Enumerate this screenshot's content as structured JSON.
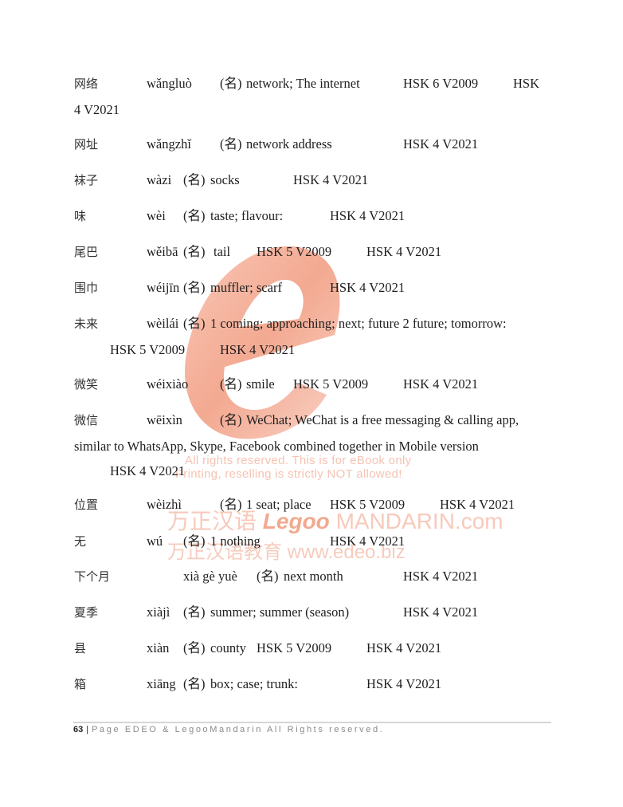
{
  "watermark": {
    "letter": "e",
    "line1": "All rights reserved. This is for eBook only",
    "line2": "Printing, reselling is strictly NOT allowed!",
    "line3_cn": "万正汉语",
    "line3_logo": "Legoo",
    "line3_rest": " MANDARIN.com",
    "line4_cn": "万正汉语教育",
    "line4_url": " www.edeo.biz",
    "color": "#f6c3b3"
  },
  "entries": [
    {
      "hanzi": "网络",
      "pinyin": "wǎngluò",
      "pos": "(名)",
      "def": "network; The internet",
      "hsk_2009": "HSK 6 V2009",
      "hsk_2021": "HSK 4 V2021"
    },
    {
      "hanzi": "网址",
      "pinyin": "wǎngzhǐ",
      "pos": "(名)",
      "def": "network address",
      "hsk_2021": "HSK 4 V2021"
    },
    {
      "hanzi": "袜子",
      "pinyin": "wàzi",
      "pos": "(名)",
      "def": "socks",
      "hsk_2021": "HSK 4 V2021"
    },
    {
      "hanzi": "味",
      "pinyin": "wèi",
      "pos": "(名)",
      "def": "taste; flavour:",
      "hsk_2021": "HSK 4 V2021"
    },
    {
      "hanzi": "尾巴",
      "pinyin": "wěibā",
      "pos": "(名)",
      "def": "tail",
      "hsk_2009": "HSK 5 V2009",
      "hsk_2021": "HSK 4 V2021"
    },
    {
      "hanzi": "围巾",
      "pinyin": "wéijīn",
      "pos": "(名)",
      "def": "muffler; scarf",
      "hsk_2021": "HSK 4 V2021"
    },
    {
      "hanzi": "未来",
      "pinyin": "wèilái",
      "pos": "(名)",
      "def": "1  coming; approaching; next; future  2 future; tomorrow:",
      "hsk_2009": "HSK 5 V2009",
      "hsk_2021": "HSK 4 V2021"
    },
    {
      "hanzi": "微笑",
      "pinyin": "wéixiào",
      "pos": "(名)",
      "def": "smile",
      "hsk_2009": "HSK 5 V2009",
      "hsk_2021": "HSK 4 V2021"
    },
    {
      "hanzi": "微信",
      "pinyin": "wēixìn",
      "pos": "(名)",
      "def": "WeChat; WeChat is a free messaging & calling app,",
      "def_cont": "similar to WhatsApp, Skype, Facebook combined together in Mobile version",
      "hsk_2021": "HSK 4 V2021"
    },
    {
      "hanzi": "位置",
      "pinyin": "wèizhì",
      "pos": "(名)",
      "def": "1 seat; place",
      "hsk_2009": "HSK 5 V2009",
      "hsk_2021": "HSK 4 V2021"
    },
    {
      "hanzi": "无",
      "pinyin": "wú",
      "pos": "(名)",
      "def": "1 nothing",
      "hsk_2021": "HSK 4 V2021"
    },
    {
      "hanzi": "下个月",
      "pinyin": "xià gè yuè",
      "pos": "(名)",
      "def": "next month",
      "hsk_2021": "HSK 4 V2021"
    },
    {
      "hanzi": "夏季",
      "pinyin": "xiàjì",
      "pos": "(名)",
      "def": "summer; summer (season)",
      "hsk_2021": "HSK 4 V2021"
    },
    {
      "hanzi": "县",
      "pinyin": "xiàn",
      "pos": "(名)",
      "def": "county",
      "hsk_2009": "HSK 5 V2009",
      "hsk_2021": "HSK 4 V2021"
    },
    {
      "hanzi": "箱",
      "pinyin": "xiāng",
      "pos": "(名)",
      "def": "box; case; trunk:",
      "hsk_2021": "HSK 4 V2021"
    }
  ],
  "wrapped": {
    "e0_hsk_part1": "HSK",
    "e0_hsk_part2": "4 V2021"
  },
  "footer": {
    "page_number": "63",
    "separator": "|",
    "text": "Page  EDEO & LegooMandarin  All Rights reserved."
  }
}
